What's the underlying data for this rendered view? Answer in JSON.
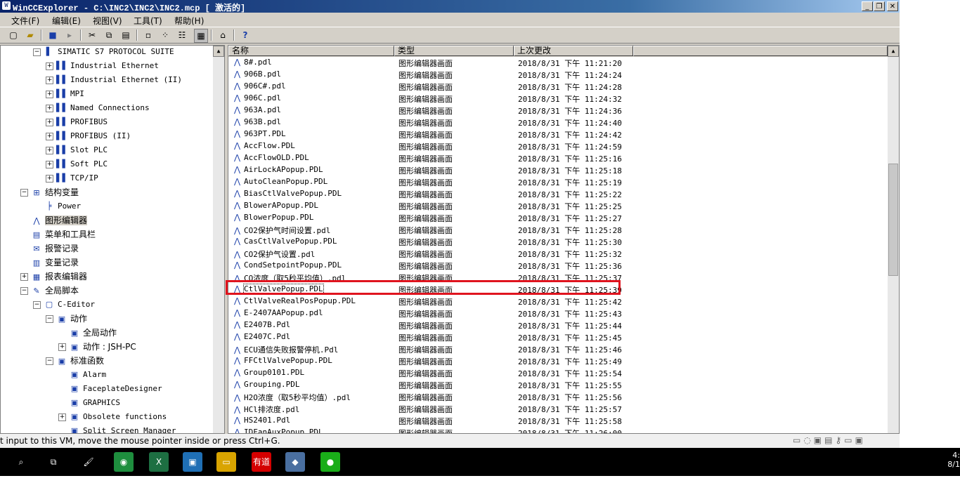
{
  "titlebar": {
    "title": "WinCCExplorer - C:\\INC2\\INC2\\INC2.mcp [ 激活的]",
    "minimize": "_",
    "restore": "❐",
    "close": "✕"
  },
  "menu": [
    "文件(F)",
    "编辑(E)",
    "视图(V)",
    "工具(T)",
    "帮助(H)"
  ],
  "help_button": "?",
  "tree": [
    {
      "label": "SIMATIC S7 PROTOCOL SUITE",
      "level": 1,
      "exp": "−",
      "icon": "plug-icon",
      "glyph": "▌"
    },
    {
      "label": "Industrial Ethernet",
      "level": 2,
      "exp": "+",
      "icon": "network-icon",
      "glyph": "▌▌"
    },
    {
      "label": "Industrial Ethernet (II)",
      "level": 2,
      "exp": "+",
      "icon": "network-icon",
      "glyph": "▌▌"
    },
    {
      "label": "MPI",
      "level": 2,
      "exp": "+",
      "icon": "network-icon",
      "glyph": "▌▌"
    },
    {
      "label": "Named Connections",
      "level": 2,
      "exp": "+",
      "icon": "network-icon",
      "glyph": "▌▌"
    },
    {
      "label": "PROFIBUS",
      "level": 2,
      "exp": "+",
      "icon": "network-icon",
      "glyph": "▌▌"
    },
    {
      "label": "PROFIBUS (II)",
      "level": 2,
      "exp": "+",
      "icon": "network-icon",
      "glyph": "▌▌"
    },
    {
      "label": "Slot PLC",
      "level": 2,
      "exp": "+",
      "icon": "network-icon",
      "glyph": "▌▌"
    },
    {
      "label": "Soft PLC",
      "level": 2,
      "exp": "+",
      "icon": "network-icon",
      "glyph": "▌▌"
    },
    {
      "label": "TCP/IP",
      "level": 2,
      "exp": "+",
      "icon": "network-icon",
      "glyph": "▌▌"
    },
    {
      "label": "结构变量",
      "level": 0,
      "exp": "−",
      "icon": "struct-tag-icon",
      "glyph": "⊞",
      "cn": true
    },
    {
      "label": "Power",
      "level": 1,
      "exp": "",
      "icon": "struct-item-icon",
      "glyph": "╞"
    },
    {
      "label": "图形编辑器",
      "level": 0,
      "exp": "",
      "icon": "graphics-designer-icon",
      "glyph": "⋀",
      "cn": true,
      "selected": true
    },
    {
      "label": "菜单和工具栏",
      "level": 0,
      "exp": "",
      "icon": "menu-toolbar-icon",
      "glyph": "▤",
      "cn": true
    },
    {
      "label": "报警记录",
      "level": 0,
      "exp": "",
      "icon": "alarm-logging-icon",
      "glyph": "✉",
      "cn": true
    },
    {
      "label": "变量记录",
      "level": 0,
      "exp": "",
      "icon": "tag-logging-icon",
      "glyph": "▥",
      "cn": true
    },
    {
      "label": "报表编辑器",
      "level": 0,
      "exp": "+",
      "icon": "report-designer-icon",
      "glyph": "▦",
      "cn": true
    },
    {
      "label": "全局脚本",
      "level": 0,
      "exp": "−",
      "icon": "global-script-icon",
      "glyph": "✎",
      "cn": true
    },
    {
      "label": "C-Editor",
      "level": 1,
      "exp": "−",
      "icon": "c-editor-icon",
      "glyph": "▢"
    },
    {
      "label": "动作",
      "level": 2,
      "exp": "−",
      "icon": "action-icon",
      "glyph": "▣",
      "cn": true
    },
    {
      "label": "全局动作",
      "level": 3,
      "exp": "",
      "icon": "action-item-icon",
      "glyph": "▣",
      "cn": true
    },
    {
      "label": "动作 : JSH-PC",
      "level": 3,
      "exp": "+",
      "icon": "action-item-icon",
      "glyph": "▣",
      "cn": true
    },
    {
      "label": "标准函数",
      "level": 2,
      "exp": "−",
      "icon": "function-icon",
      "glyph": "▣",
      "cn": true
    },
    {
      "label": "Alarm",
      "level": 3,
      "exp": "",
      "icon": "function-item-icon",
      "glyph": "▣"
    },
    {
      "label": "FaceplateDesigner",
      "level": 3,
      "exp": "",
      "icon": "function-item-icon",
      "glyph": "▣"
    },
    {
      "label": "GRAPHICS",
      "level": 3,
      "exp": "",
      "icon": "function-item-icon",
      "glyph": "▣"
    },
    {
      "label": "Obsolete functions",
      "level": 3,
      "exp": "+",
      "icon": "function-item-icon",
      "glyph": "▣"
    },
    {
      "label": "Split Screen Manager",
      "level": 3,
      "exp": "",
      "icon": "function-item-icon",
      "glyph": "▣"
    }
  ],
  "columns": [
    "名称",
    "类型",
    "上次更改"
  ],
  "files": [
    {
      "name": "8#.pdl",
      "type": "图形编辑器画面",
      "modified": "2018/8/31 下午 11:21:20"
    },
    {
      "name": "906B.pdl",
      "type": "图形编辑器画面",
      "modified": "2018/8/31 下午 11:24:24"
    },
    {
      "name": "906C#.pdl",
      "type": "图形编辑器画面",
      "modified": "2018/8/31 下午 11:24:28"
    },
    {
      "name": "906C.pdl",
      "type": "图形编辑器画面",
      "modified": "2018/8/31 下午 11:24:32"
    },
    {
      "name": "963A.pdl",
      "type": "图形编辑器画面",
      "modified": "2018/8/31 下午 11:24:36"
    },
    {
      "name": "963B.pdl",
      "type": "图形编辑器画面",
      "modified": "2018/8/31 下午 11:24:40"
    },
    {
      "name": "963PT.PDL",
      "type": "图形编辑器画面",
      "modified": "2018/8/31 下午 11:24:42"
    },
    {
      "name": "AccFlow.PDL",
      "type": "图形编辑器画面",
      "modified": "2018/8/31 下午 11:24:59"
    },
    {
      "name": "AccFlowOLD.PDL",
      "type": "图形编辑器画面",
      "modified": "2018/8/31 下午 11:25:16"
    },
    {
      "name": "AirLockAPopup.PDL",
      "type": "图形编辑器画面",
      "modified": "2018/8/31 下午 11:25:18"
    },
    {
      "name": "AutoCleanPopup.PDL",
      "type": "图形编辑器画面",
      "modified": "2018/8/31 下午 11:25:19"
    },
    {
      "name": "BiasCtlValvePopup.PDL",
      "type": "图形编辑器画面",
      "modified": "2018/8/31 下午 11:25:22"
    },
    {
      "name": "BlowerAPopup.PDL",
      "type": "图形编辑器画面",
      "modified": "2018/8/31 下午 11:25:25"
    },
    {
      "name": "BlowerPopup.PDL",
      "type": "图形编辑器画面",
      "modified": "2018/8/31 下午 11:25:27"
    },
    {
      "name": "CO2保护气时间设置.pdl",
      "type": "图形编辑器画面",
      "modified": "2018/8/31 下午 11:25:28"
    },
    {
      "name": "CasCtlValvePopup.PDL",
      "type": "图形编辑器画面",
      "modified": "2018/8/31 下午 11:25:30"
    },
    {
      "name": "CO2保护气设置.pdl",
      "type": "图形编辑器画面",
      "modified": "2018/8/31 下午 11:25:32"
    },
    {
      "name": "CondSetpointPopup.PDL",
      "type": "图形编辑器画面",
      "modified": "2018/8/31 下午 11:25:36"
    },
    {
      "name": "CO浓度（取5秒平均值）.pdl",
      "type": "图形编辑器画面",
      "modified": "2018/8/31 下午 11:25:37"
    },
    {
      "name": "CtlValvePopup.PDL",
      "type": "图形编辑器画面",
      "modified": "2018/8/31 下午 11:25:39",
      "selected": true
    },
    {
      "name": "CtlValveRealPosPopup.PDL",
      "type": "图形编辑器画面",
      "modified": "2018/8/31 下午 11:25:42"
    },
    {
      "name": "E-2407AAPopup.pdl",
      "type": "图形编辑器画面",
      "modified": "2018/8/31 下午 11:25:43"
    },
    {
      "name": "E2407B.Pdl",
      "type": "图形编辑器画面",
      "modified": "2018/8/31 下午 11:25:44"
    },
    {
      "name": "E2407C.Pdl",
      "type": "图形编辑器画面",
      "modified": "2018/8/31 下午 11:25:45"
    },
    {
      "name": "ECU通信失败报警停机.Pdl",
      "type": "图形编辑器画面",
      "modified": "2018/8/31 下午 11:25:46"
    },
    {
      "name": "FFCtlValvePopup.PDL",
      "type": "图形编辑器画面",
      "modified": "2018/8/31 下午 11:25:49"
    },
    {
      "name": "Group0101.PDL",
      "type": "图形编辑器画面",
      "modified": "2018/8/31 下午 11:25:54"
    },
    {
      "name": "Grouping.PDL",
      "type": "图形编辑器画面",
      "modified": "2018/8/31 下午 11:25:55"
    },
    {
      "name": "H2O浓度（取5秒平均值）.pdl",
      "type": "图形编辑器画面",
      "modified": "2018/8/31 下午 11:25:56"
    },
    {
      "name": "HCl排浓度.pdl",
      "type": "图形编辑器画面",
      "modified": "2018/8/31 下午 11:25:57"
    },
    {
      "name": "HS2401.Pdl",
      "type": "图形编辑器画面",
      "modified": "2018/8/31 下午 11:25:58"
    },
    {
      "name": "IDFanAuxPopup.PDL",
      "type": "图形编辑器画面",
      "modified": "2018/8/31 下午 11:26:00"
    }
  ],
  "statusbar": {
    "text": "t input to this VM, move the mouse pointer inside or press Ctrl+G."
  },
  "taskbar": {
    "items": [
      {
        "name": "search-icon",
        "glyph": "⌕",
        "bg": "#000000"
      },
      {
        "name": "task-view-icon",
        "glyph": "⧉",
        "bg": "#000000"
      },
      {
        "name": "paint-app-icon",
        "glyph": "🖌",
        "bg": "#000000"
      },
      {
        "name": "chrome-app-icon",
        "glyph": "◉",
        "bg": "#1e8e3e"
      },
      {
        "name": "excel-app-icon",
        "glyph": "X",
        "bg": "#1d6f42"
      },
      {
        "name": "app-window-icon",
        "glyph": "▣",
        "bg": "#1f6fb5"
      },
      {
        "name": "file-explorer-icon",
        "glyph": "▭",
        "bg": "#d9a400"
      },
      {
        "name": "youdao-app-icon",
        "glyph": "有道",
        "bg": "#d40000"
      },
      {
        "name": "notes-app-icon",
        "glyph": "◆",
        "bg": "#4a6fa0"
      },
      {
        "name": "wechat-app-icon",
        "glyph": "●",
        "bg": "#1aad19"
      }
    ],
    "clock_time": "4:",
    "clock_date": "8/1"
  },
  "colors": {
    "highlight_box": "#e0141e",
    "titlebar": "#0a246a"
  }
}
